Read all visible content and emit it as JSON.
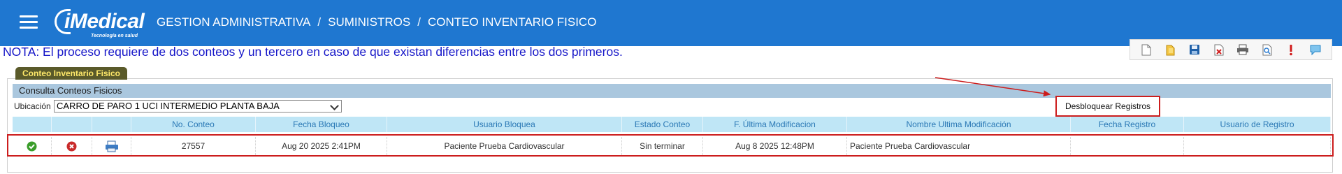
{
  "header": {
    "logo_text": "iMedical",
    "logo_tagline": "Tecnología en salud",
    "breadcrumb": [
      "GESTION ADMINISTRATIVA",
      "SUMINISTROS",
      "CONTEO INVENTARIO FISICO"
    ],
    "separator": "/"
  },
  "note": "NOTA: El proceso requiere de dos conteos y un tercero en caso de que existan diferencias entre los dos primeros.",
  "toolbar": {
    "icons": [
      "new-document-icon",
      "open-folder-icon",
      "save-icon",
      "delete-document-icon",
      "print-icon",
      "preview-icon",
      "alert-icon",
      "help-chat-icon"
    ]
  },
  "panel": {
    "tab_label": "Conteo Inventario Fisico",
    "section_title": "Consulta Conteos Fisicos",
    "ubicacion_label": "Ubicación",
    "ubicacion_value": "CARRO DE PARO 1 UCI INTERMEDIO PLANTA BAJA",
    "unlock_button": "Desbloquear Registros"
  },
  "table": {
    "columns": [
      "",
      "",
      "",
      "No. Conteo",
      "Fecha Bloqueo",
      "Usuario Bloquea",
      "Estado Conteo",
      "F. Última Modificacion",
      "Nombre Ultima Modificación",
      "Fecha Registro",
      "Usuario de Registro"
    ],
    "rows": [
      {
        "no_conteo": "27557",
        "fecha_bloqueo": "Aug 20 2025 2:41PM",
        "usuario_bloquea": "Paciente Prueba Cardiovascular",
        "estado_conteo": "Sin terminar",
        "f_ultima_modificacion": "Aug 8 2025 12:48PM",
        "nombre_ultima_modificacion": "Paciente Prueba Cardiovascular",
        "fecha_registro": "",
        "usuario_registro": ""
      }
    ]
  },
  "colors": {
    "header_bg": "#1f77d0",
    "note_text": "#1515c8",
    "highlight": "#cc1d1d",
    "table_header_bg": "#bfe6f6"
  }
}
